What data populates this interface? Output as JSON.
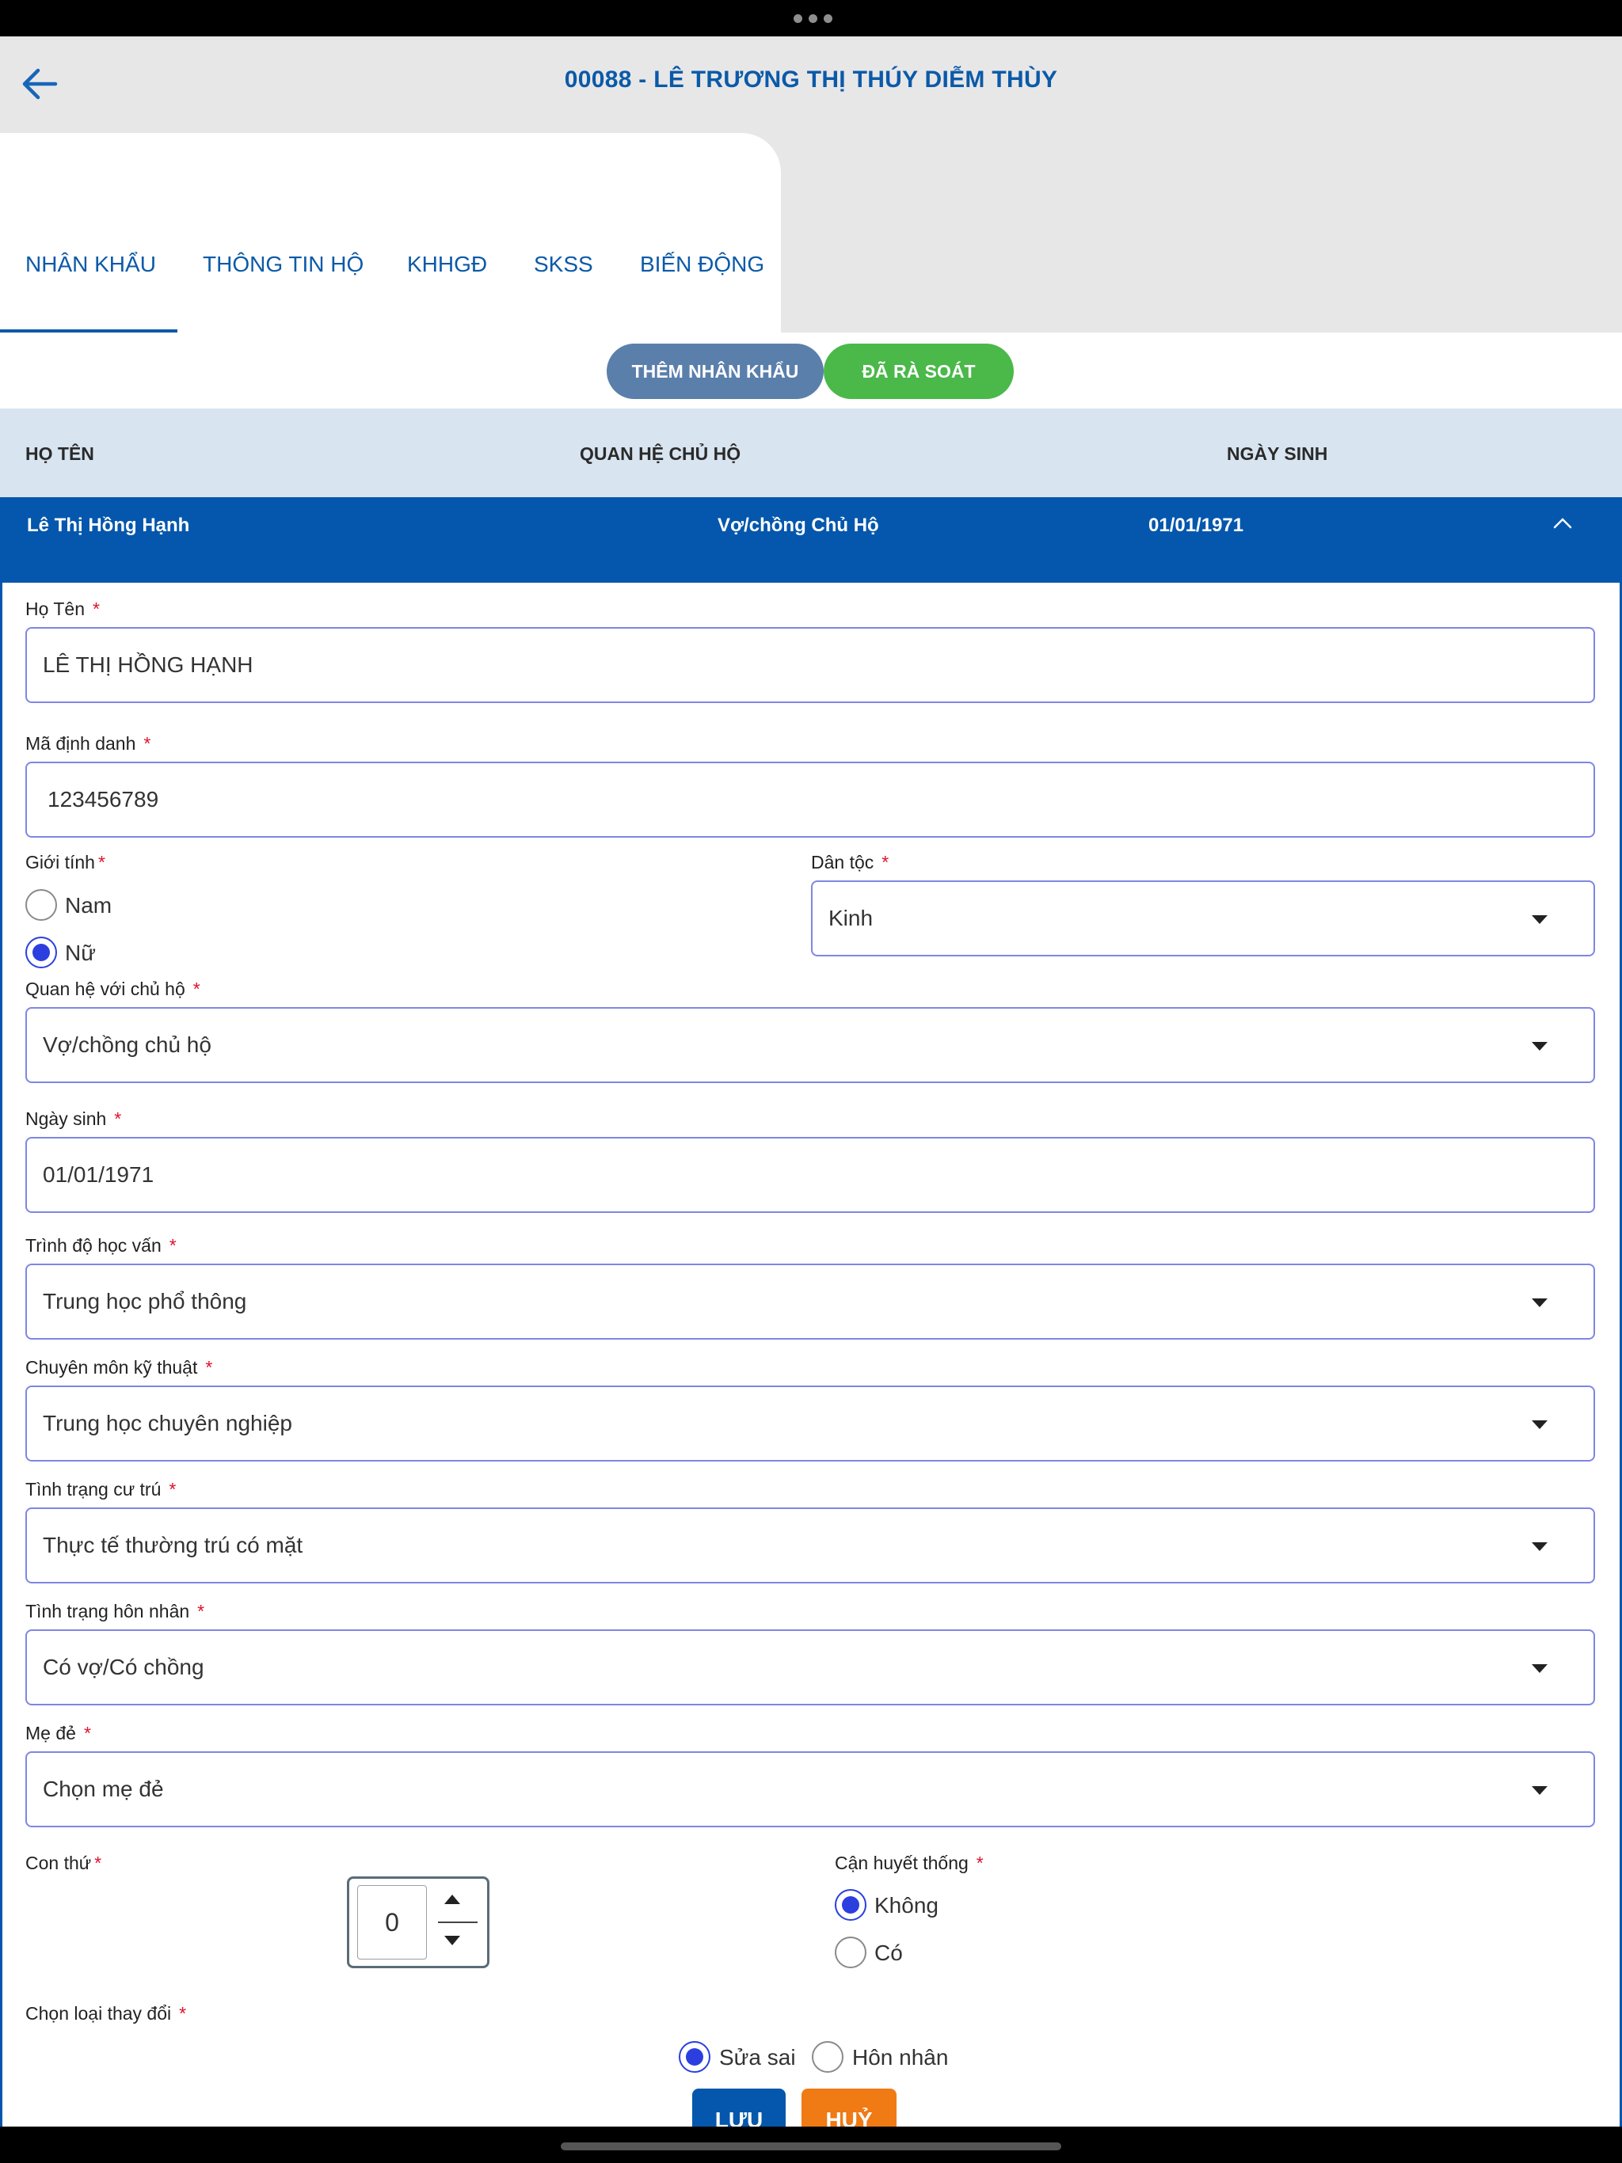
{
  "header": {
    "title": "00088 - LÊ TRƯƠNG THỊ THÚY DIỄM THÙY"
  },
  "tabs": [
    {
      "label": "NHÂN KHẨU",
      "active": true
    },
    {
      "label": "THÔNG TIN HỘ",
      "active": false
    },
    {
      "label": "KHHGĐ",
      "active": false
    },
    {
      "label": "SKSS",
      "active": false
    },
    {
      "label": "BIẾN ĐỘNG",
      "active": false
    }
  ],
  "actions": {
    "add_member": "THÊM NHÂN KHẨU",
    "reviewed": "ĐÃ RÀ SOÁT"
  },
  "table": {
    "headers": {
      "name": "HỌ TÊN",
      "relation": "QUAN HỆ CHỦ HỘ",
      "dob": "NGÀY SINH"
    },
    "selected_row": {
      "name": "Lê Thị Hồng Hạnh",
      "relation": "Vợ/chồng Chủ Hộ",
      "dob": "01/01/1971"
    }
  },
  "form": {
    "required_mark": "*",
    "ho_ten": {
      "label": "Họ Tên",
      "value": "LÊ THỊ HỒNG HẠNH"
    },
    "ma_dinh_danh": {
      "label": "Mã định danh",
      "value": "123456789"
    },
    "gioi_tinh": {
      "label": "Giới tính",
      "options": [
        "Nam",
        "Nữ"
      ],
      "selected": "Nữ"
    },
    "dan_toc": {
      "label": "Dân tộc",
      "value": "Kinh"
    },
    "quan_he": {
      "label": "Quan hệ với chủ hộ",
      "value": "Vợ/chồng chủ hộ"
    },
    "ngay_sinh": {
      "label": "Ngày sinh",
      "value": "01/01/1971"
    },
    "trinh_do": {
      "label": "Trình độ học vấn",
      "value": "Trung học phổ thông"
    },
    "chuyen_mon": {
      "label": "Chuyên môn kỹ thuật",
      "value": "Trung học chuyên nghiệp"
    },
    "cu_tru": {
      "label": "Tình trạng cư trú",
      "value": "Thực tế thường trú có mặt"
    },
    "hon_nhan": {
      "label": "Tình trạng hôn nhân",
      "value": "Có vợ/Có chồng"
    },
    "me_de": {
      "label": "Mẹ đẻ",
      "value": "Chọn mẹ đẻ"
    },
    "con_thu": {
      "label": "Con thứ",
      "value": "0"
    },
    "can_huyet_thong": {
      "label": "Cận huyết thống",
      "options": [
        "Không",
        "Có"
      ],
      "selected": "Không"
    },
    "loai_thay_doi": {
      "label": "Chọn loại thay đổi",
      "options": [
        "Sửa sai",
        "Hôn nhân"
      ],
      "selected": "Sửa sai"
    }
  },
  "buttons": {
    "save": "LƯU",
    "cancel": "HUỶ"
  },
  "colors": {
    "primary": "#0457ac",
    "reviewed_green": "#4bb84a",
    "add_button": "#5b7fab",
    "cancel_orange": "#f07a14",
    "required_red": "#e0112b",
    "radio_selected": "#2b3fe0"
  }
}
